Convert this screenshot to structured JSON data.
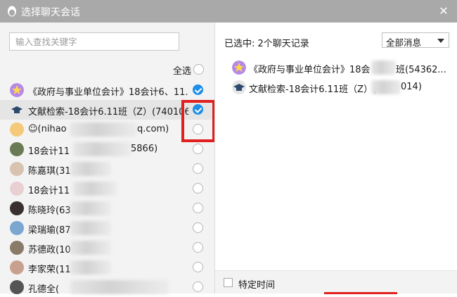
{
  "window": {
    "title": "选择聊天会话"
  },
  "search": {
    "placeholder": "输入查找关键字"
  },
  "select_all": {
    "label": "全选"
  },
  "contacts": [
    {
      "name": "《政府与事业单位会计》18会计6、11...",
      "checked": true,
      "avatar": "star-group-icon"
    },
    {
      "name": "文献检索-18会计6.11班（Z）(740106...",
      "checked": true,
      "avatar": "graduation-cap-icon"
    },
    {
      "name": "☺(nihao",
      "name_tail": "q.com)",
      "checked": false,
      "avatar": "cartoon-avatar"
    },
    {
      "name": "18会计11",
      "name_tail": "5866)",
      "checked": false,
      "avatar": "photo-avatar"
    },
    {
      "name": "陈嘉琪(31",
      "checked": false,
      "avatar": "photo-avatar"
    },
    {
      "name": "18会计11",
      "checked": false,
      "avatar": "photo-avatar"
    },
    {
      "name": "陈晓玲(63",
      "checked": false,
      "avatar": "photo-avatar"
    },
    {
      "name": "梁瑞瑜(87",
      "checked": false,
      "avatar": "photo-avatar"
    },
    {
      "name": "苏德政(10",
      "checked": false,
      "avatar": "photo-avatar"
    },
    {
      "name": "李家荣(11",
      "checked": false,
      "avatar": "photo-avatar"
    },
    {
      "name": "孔德全(",
      "checked": false,
      "avatar": "photo-avatar"
    }
  ],
  "selected_panel": {
    "count_label": "已选中: 2个聊天记录",
    "filter_value": "全部消息",
    "items": [
      {
        "name": "《政府与事业单位会计》18会",
        "name_tail": "班(54362...",
        "avatar": "star-group-icon"
      },
      {
        "name": "文献检索-18会计6.11班（Z）(",
        "name_tail": "014)",
        "avatar": "graduation-cap-icon"
      }
    ]
  },
  "footer": {
    "specific_time_label": "特定时间"
  },
  "colors": {
    "titlebar": "#a9a9a9",
    "accent": "#1e8ee8",
    "highlight": "#e02020"
  }
}
